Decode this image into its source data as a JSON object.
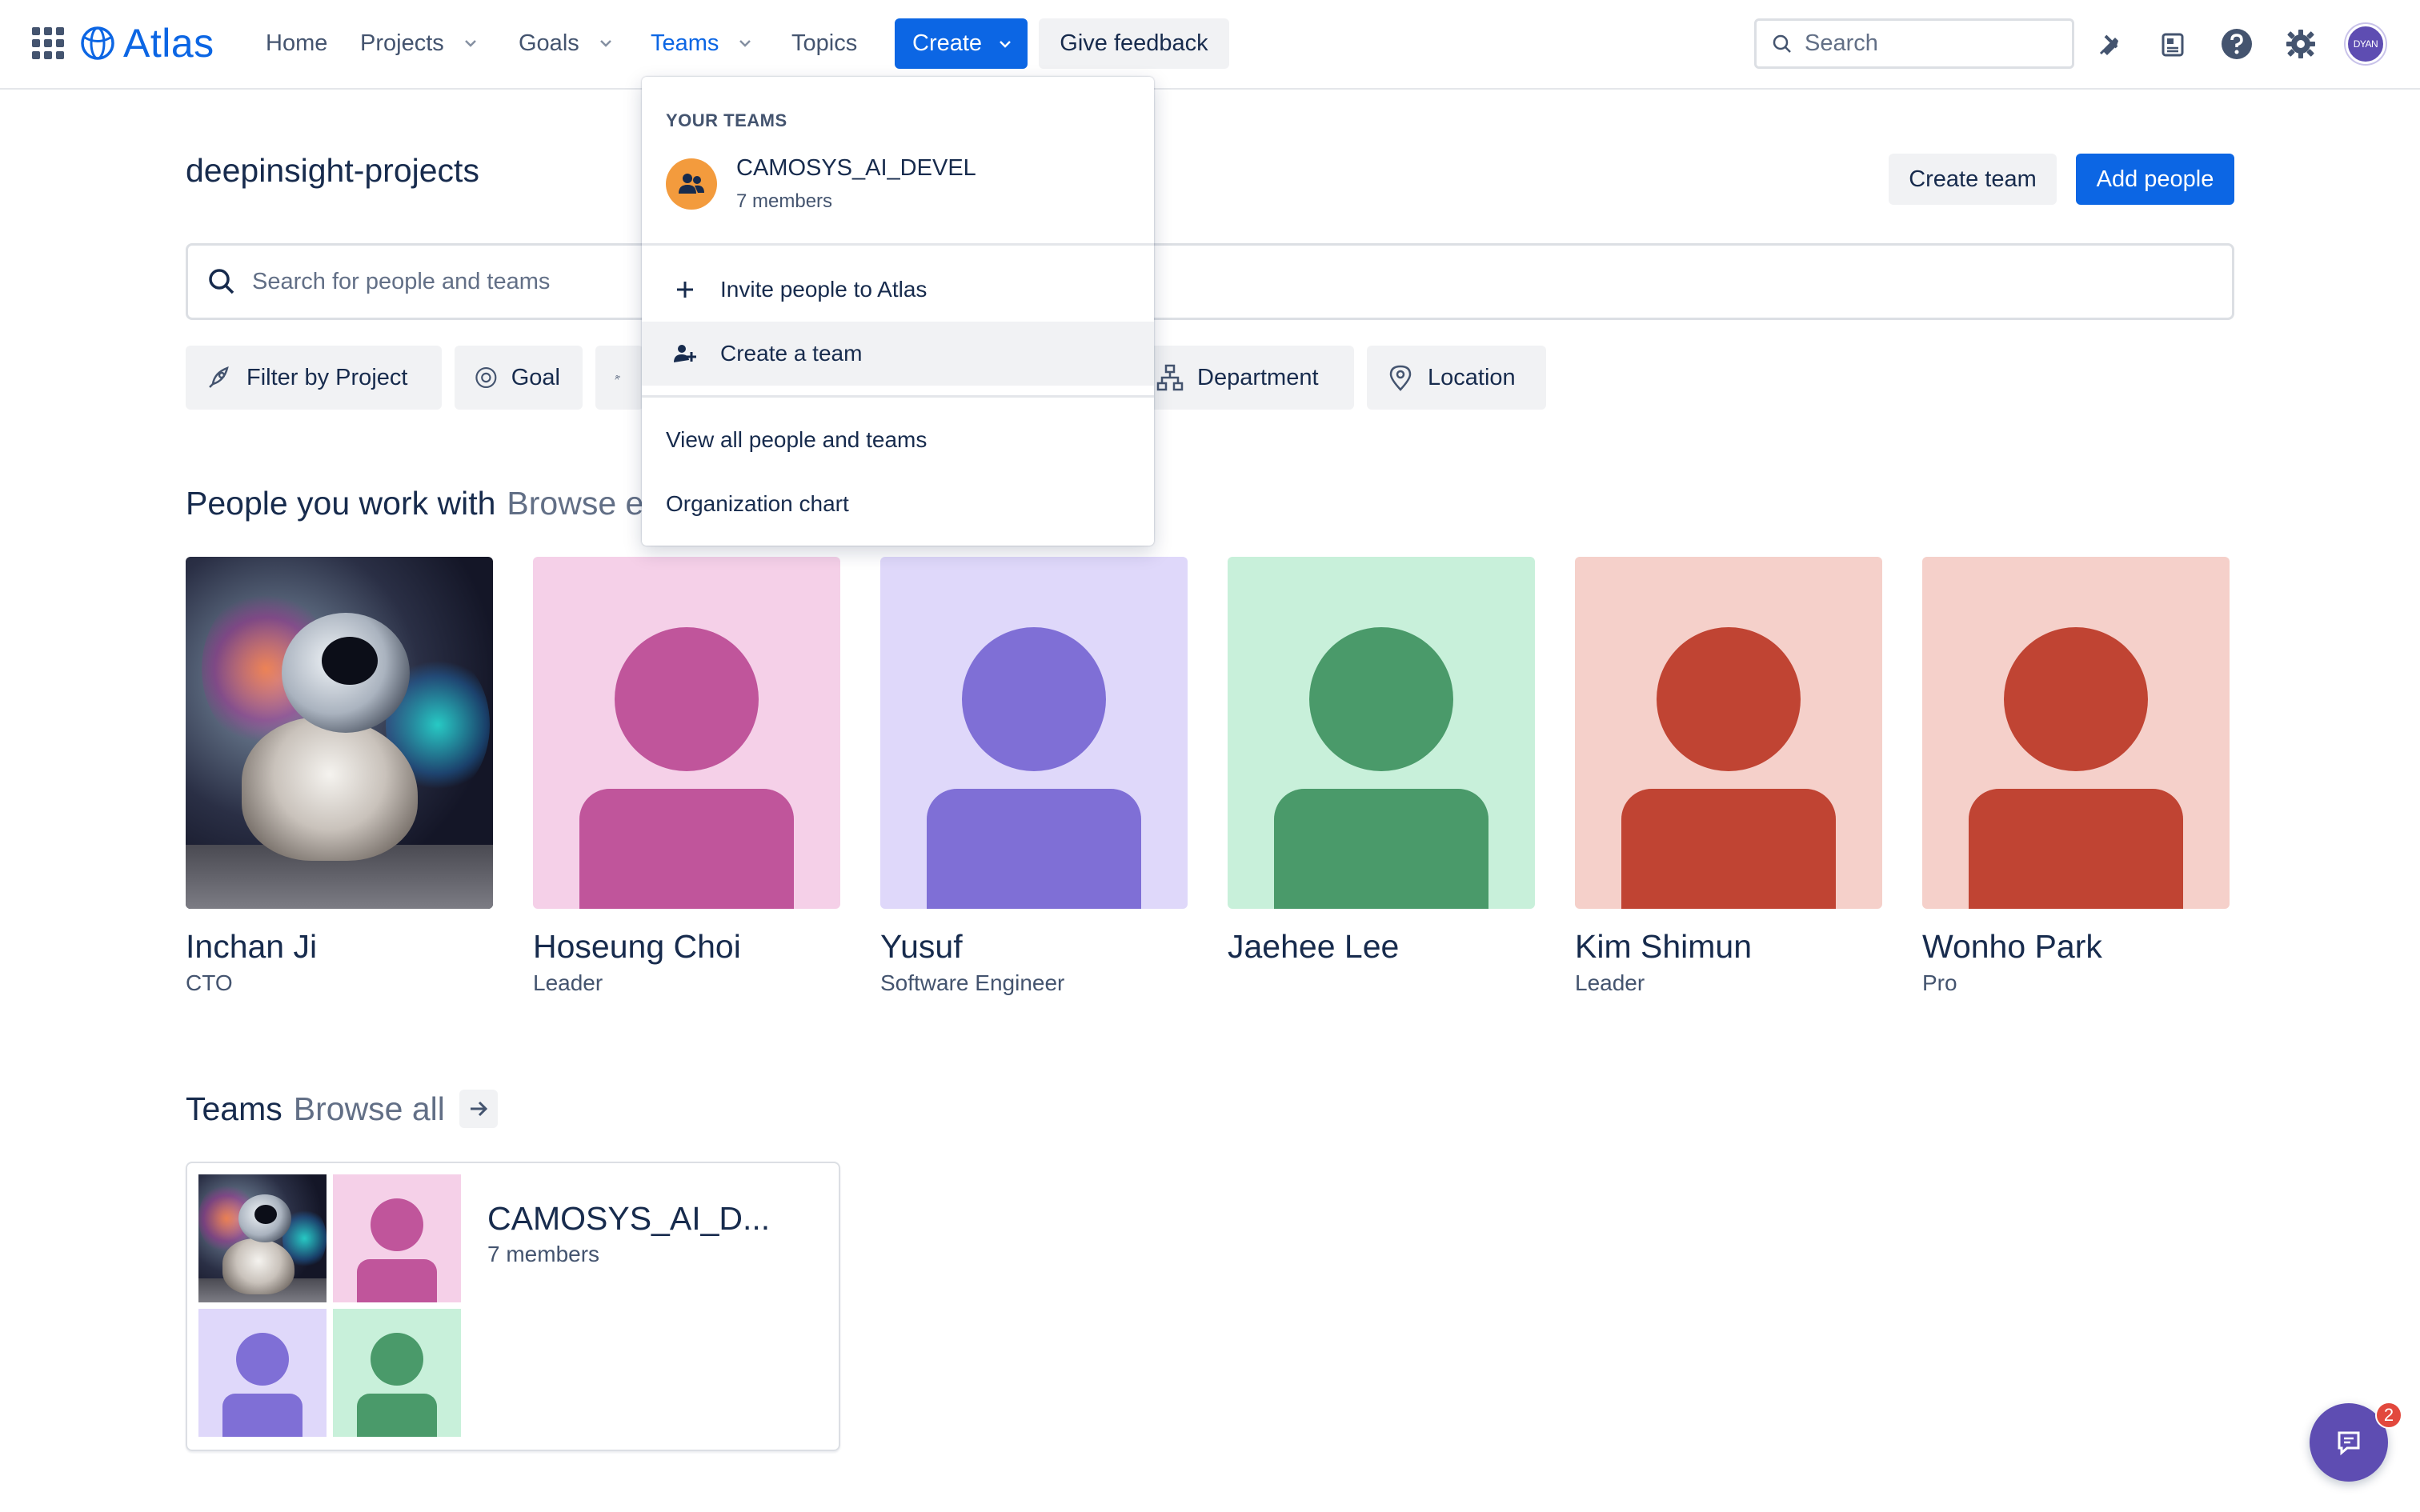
{
  "nav": {
    "brand": "Atlas",
    "items": [
      {
        "label": "Home"
      },
      {
        "label": "Projects"
      },
      {
        "label": "Goals"
      },
      {
        "label": "Teams"
      },
      {
        "label": "Topics"
      }
    ],
    "create_label": "Create",
    "feedback_label": "Give feedback",
    "search_placeholder": "Search",
    "user_initials": "DYAN"
  },
  "page": {
    "title": "deepinsight-projects",
    "create_team_label": "Create team",
    "add_people_label": "Add people",
    "search_placeholder": "Search for people and teams",
    "filters": [
      {
        "label": "Filter by Project",
        "icon": "rocket-icon"
      },
      {
        "label": "Goal",
        "icon": "target-icon"
      },
      {
        "label": "",
        "icon": "people-icon"
      },
      {
        "label": "Department",
        "icon": "org-chart-icon"
      },
      {
        "label": "Location",
        "icon": "location-pin-icon"
      }
    ]
  },
  "people_section": {
    "title": "People you work with",
    "browse": "Browse ev",
    "people": [
      {
        "name": "Inchan Ji",
        "role": "CTO",
        "avatar": "photo"
      },
      {
        "name": "Hoseung Choi",
        "role": "Leader",
        "bg": "#f5d0e8",
        "fg": "#c0559b"
      },
      {
        "name": "Yusuf",
        "role": "Software Engineer",
        "bg": "#dfd8fa",
        "fg": "#7f6fd6"
      },
      {
        "name": "Jaehee Lee",
        "role": "",
        "bg": "#c8f0da",
        "fg": "#4a9a6a"
      },
      {
        "name": "Kim Shimun",
        "role": "Leader",
        "bg": "#f5d0ca",
        "fg": "#c04433"
      },
      {
        "name": "Wonho Park",
        "role": "Pro",
        "bg": "#f5d0ca",
        "fg": "#c04433"
      }
    ]
  },
  "teams_section": {
    "title": "Teams",
    "browse": "Browse all",
    "team": {
      "name": "CAMOSYS_AI_D...",
      "members": "7 members"
    }
  },
  "dropdown": {
    "heading": "YOUR TEAMS",
    "team_name": "CAMOSYS_AI_DEVEL",
    "team_members": "7 members",
    "items": [
      {
        "label": "Invite people to Atlas",
        "icon": "plus-icon"
      },
      {
        "label": "Create a team",
        "icon": "people-icon"
      },
      {
        "label": "View all people and teams"
      },
      {
        "label": "Organization chart"
      }
    ]
  },
  "chat": {
    "badge": "2"
  },
  "colors": {
    "accent": "#0c66e4",
    "text": "#172b4d",
    "subtle": "#44546f"
  }
}
